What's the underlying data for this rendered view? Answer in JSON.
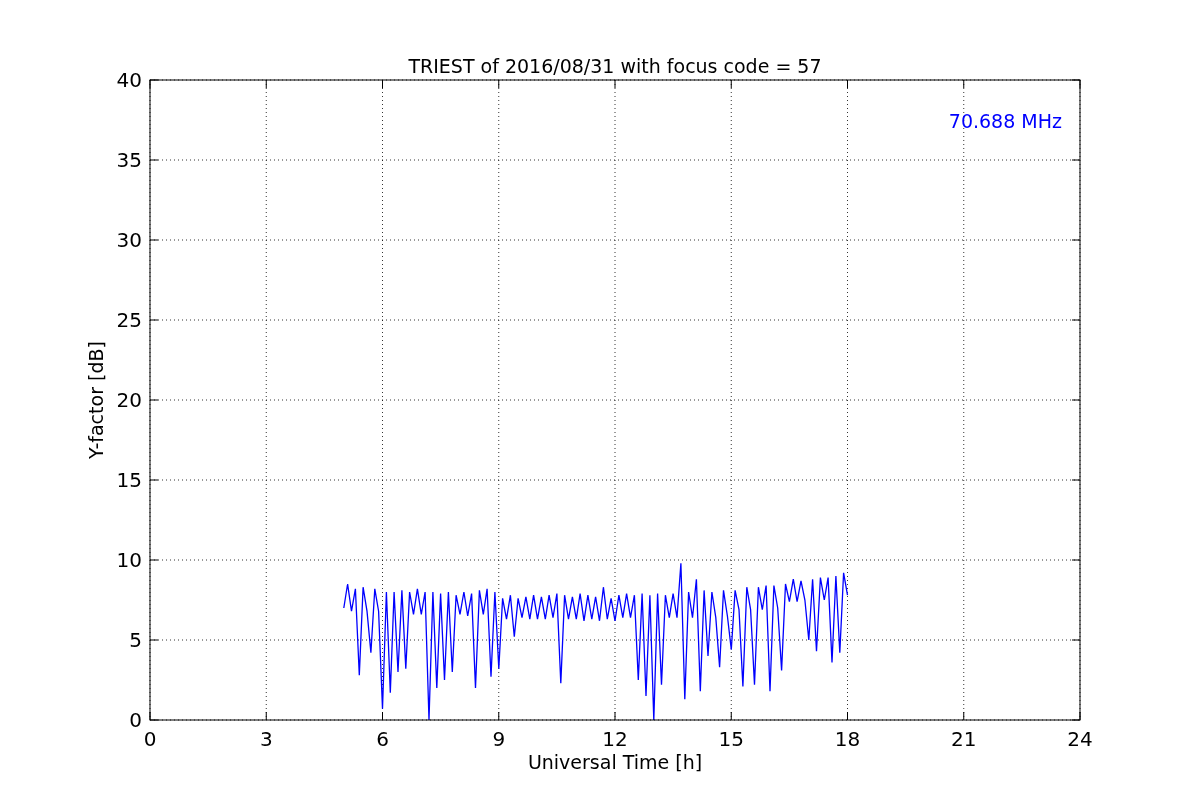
{
  "figure": {
    "chart_data": {
      "type": "line",
      "title": "TRIEST of 2016/08/31 with focus code = 57",
      "xlabel": "Universal Time [h]",
      "ylabel": "Y-factor [dB]",
      "xlim": [
        0,
        24
      ],
      "ylim": [
        0,
        40
      ],
      "grid": true,
      "xticks": [
        0,
        3,
        6,
        9,
        12,
        15,
        18,
        21,
        24
      ],
      "yticks": [
        0,
        5,
        10,
        15,
        20,
        25,
        30,
        35,
        40
      ],
      "x": [
        5.0,
        5.1,
        5.2,
        5.3,
        5.4,
        5.5,
        5.6,
        5.7,
        5.8,
        5.9,
        6.0,
        6.1,
        6.2,
        6.3,
        6.4,
        6.5,
        6.6,
        6.7,
        6.8,
        6.9,
        7.0,
        7.1,
        7.2,
        7.3,
        7.4,
        7.5,
        7.6,
        7.7,
        7.8,
        7.9,
        8.0,
        8.1,
        8.2,
        8.3,
        8.4,
        8.5,
        8.6,
        8.7,
        8.8,
        8.9,
        9.0,
        9.1,
        9.2,
        9.3,
        9.4,
        9.5,
        9.6,
        9.7,
        9.8,
        9.9,
        10.0,
        10.1,
        10.2,
        10.3,
        10.4,
        10.5,
        10.6,
        10.7,
        10.8,
        10.9,
        11.0,
        11.1,
        11.2,
        11.3,
        11.4,
        11.5,
        11.6,
        11.7,
        11.8,
        11.9,
        12.0,
        12.1,
        12.2,
        12.3,
        12.4,
        12.5,
        12.6,
        12.7,
        12.8,
        12.9,
        13.0,
        13.1,
        13.2,
        13.3,
        13.4,
        13.5,
        13.6,
        13.7,
        13.8,
        13.9,
        14.0,
        14.1,
        14.2,
        14.3,
        14.4,
        14.5,
        14.6,
        14.7,
        14.8,
        14.9,
        15.0,
        15.1,
        15.2,
        15.3,
        15.4,
        15.5,
        15.6,
        15.7,
        15.8,
        15.9,
        16.0,
        16.1,
        16.2,
        16.3,
        16.4,
        16.5,
        16.6,
        16.7,
        16.8,
        16.9,
        17.0,
        17.1,
        17.2,
        17.3,
        17.4,
        17.5,
        17.6,
        17.7,
        17.8,
        17.9,
        18.0
      ],
      "series": [
        {
          "color": "#0000ff",
          "values": [
            7.0,
            8.5,
            6.8,
            8.2,
            2.8,
            8.3,
            6.8,
            4.2,
            8.2,
            6.8,
            0.7,
            8.0,
            1.7,
            8.0,
            3.0,
            8.1,
            3.2,
            8.0,
            6.6,
            8.2,
            6.6,
            8.0,
            0,
            8.0,
            2.0,
            7.9,
            2.5,
            8.0,
            3.0,
            7.8,
            6.6,
            8.0,
            6.5,
            7.9,
            2.0,
            8.1,
            6.6,
            8.2,
            2.7,
            8.0,
            3.2,
            7.6,
            6.3,
            7.8,
            5.2,
            7.6,
            6.4,
            7.7,
            6.3,
            7.8,
            6.3,
            7.7,
            6.3,
            7.8,
            6.4,
            7.9,
            2.3,
            7.8,
            6.3,
            7.7,
            6.3,
            7.9,
            6.2,
            7.8,
            6.3,
            7.7,
            6.2,
            8.3,
            6.3,
            7.6,
            6.2,
            7.8,
            6.4,
            7.9,
            6.4,
            7.8,
            2.5,
            7.9,
            1.5,
            7.8,
            0,
            7.9,
            2.2,
            7.8,
            6.4,
            7.9,
            6.4,
            9.8,
            1.3,
            8.0,
            6.4,
            8.8,
            1.8,
            8.1,
            4.0,
            8.0,
            6.4,
            3.3,
            8.1,
            6.5,
            4.4,
            8.1,
            6.9,
            2.1,
            8.3,
            6.9,
            2.2,
            8.3,
            6.9,
            8.4,
            1.8,
            8.4,
            7.0,
            3.1,
            8.5,
            7.4,
            8.8,
            7.4,
            8.7,
            7.5,
            5.0,
            8.8,
            4.3,
            8.9,
            7.5,
            8.9,
            3.6,
            9.0,
            4.2,
            9.2,
            7.8
          ]
        }
      ],
      "annotations": [
        {
          "text": "70.688 MHz"
        }
      ]
    }
  }
}
